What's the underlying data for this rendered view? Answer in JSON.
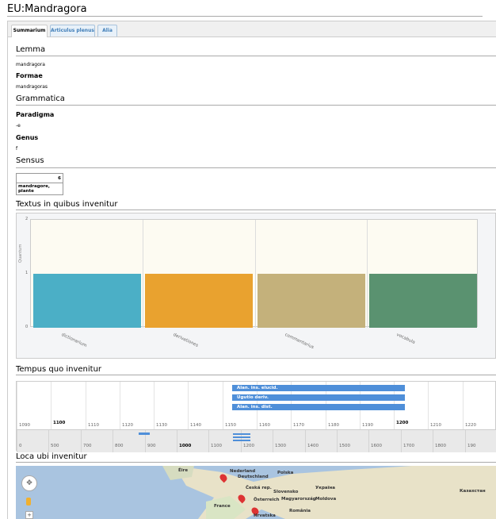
{
  "page": {
    "title": "EU:Mandragora"
  },
  "tabs": [
    {
      "label": "Summarium",
      "active": true
    },
    {
      "label": "Articulus plenus",
      "active": false
    },
    {
      "label": "Alia",
      "active": false
    }
  ],
  "sections": {
    "lemma_heading": "Lemma",
    "lemma_value": "mandragora",
    "formae_label": "Formae",
    "formae_value": "mandragoras",
    "grammatica_heading": "Grammatica",
    "paradigma_label": "Paradigma",
    "paradigma_value": "-e",
    "genus_label": "Genus",
    "genus_value": "f",
    "sensus_heading": "Sensus",
    "sensus_table": {
      "num": "6",
      "text": "mandragore, plante"
    },
    "textus_heading": "Textus in quibus invenitur",
    "tempus_heading": "Tempus quo invenitur",
    "loca_heading": "Loca ubi invenitur"
  },
  "chart_data": {
    "type": "bar",
    "ylabel": "Quantum",
    "ylim": [
      0,
      2
    ],
    "yticks": [
      "2",
      "1",
      "0"
    ],
    "categories": [
      "dictionarium",
      "derivationes",
      "commentarius",
      "vocabula"
    ],
    "values": [
      1,
      1,
      1,
      1
    ],
    "colors": [
      "#4bafc6",
      "#e9a22f",
      "#c4b17b",
      "#5a9270"
    ]
  },
  "timeline": {
    "upper_ticks": [
      "1090",
      "1100",
      "1110",
      "1120",
      "1130",
      "1140",
      "1150",
      "1160",
      "1170",
      "1180",
      "1190",
      "1200",
      "1210",
      "1220"
    ],
    "upper_bold": [
      "1100",
      "1200"
    ],
    "events": [
      "Alan. ins. elucid.",
      "Ugutio deriv.",
      "Alan. ins. dist."
    ],
    "lower_ticks": [
      "0",
      "500",
      "700",
      "800",
      "900",
      "1000",
      "1100",
      "1200",
      "1300",
      "1400",
      "1500",
      "1600",
      "1700",
      "1800",
      "190"
    ],
    "lower_bold": [
      "1000"
    ]
  },
  "map": {
    "labels": [
      "Éire",
      "Nederland",
      "Deutschland",
      "Polska",
      "Česká rep.",
      "Slovensko",
      "Україна",
      "France",
      "Österreich",
      "Magyarország",
      "Moldova",
      "România",
      "Hrvatska",
      "Казахстан"
    ]
  }
}
